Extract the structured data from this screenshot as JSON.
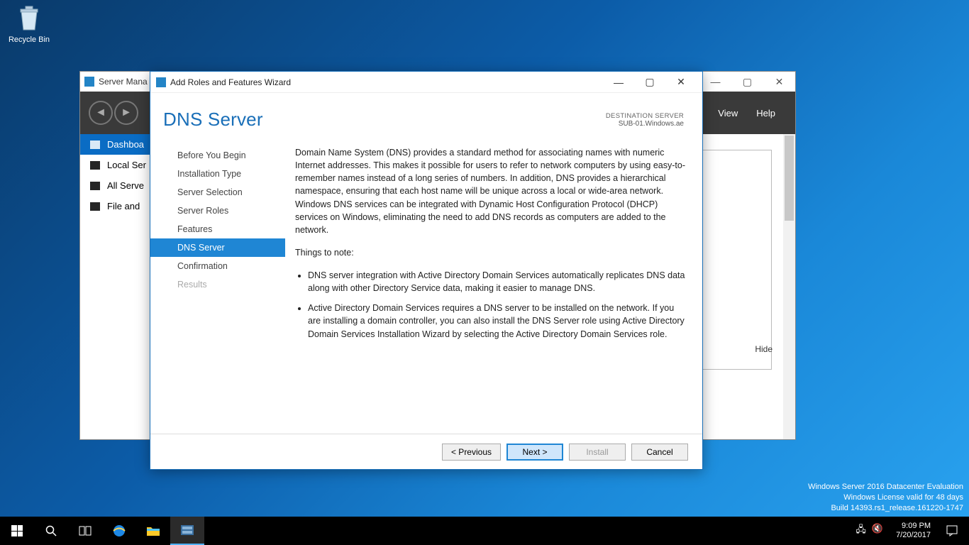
{
  "desktop": {
    "recycle_label": "Recycle Bin"
  },
  "watermark": {
    "line1": "Windows Server 2016 Datacenter Evaluation",
    "line2": "Windows License valid for 48 days",
    "line3": "Build 14393.rs1_release.161220-1747"
  },
  "servermgr": {
    "title": "Server Mana",
    "menu": {
      "view": "View",
      "help": "Help"
    },
    "sidebar": {
      "items": [
        {
          "label": "Dashboa",
          "selected": true
        },
        {
          "label": "Local Ser",
          "selected": false
        },
        {
          "label": "All Serve",
          "selected": false
        },
        {
          "label": "File and",
          "selected": false
        }
      ]
    },
    "hide": "Hide"
  },
  "wizard": {
    "title_bar": "Add Roles and Features Wizard",
    "page_title": "DNS Server",
    "dest_label": "DESTINATION SERVER",
    "dest_value": "SUB-01.Windows.ae",
    "steps": [
      {
        "label": "Before You Begin",
        "state": ""
      },
      {
        "label": "Installation Type",
        "state": ""
      },
      {
        "label": "Server Selection",
        "state": ""
      },
      {
        "label": "Server Roles",
        "state": ""
      },
      {
        "label": "Features",
        "state": ""
      },
      {
        "label": "DNS Server",
        "state": "selected"
      },
      {
        "label": "Confirmation",
        "state": ""
      },
      {
        "label": "Results",
        "state": "disabled"
      }
    ],
    "content": {
      "intro": "Domain Name System (DNS) provides a standard method for associating names with numeric Internet addresses. This makes it possible for users to refer to network computers by using easy-to-remember names instead of a long series of numbers. In addition, DNS provides a hierarchical namespace, ensuring that each host name will be unique across a local or wide-area network. Windows DNS services can be integrated with Dynamic Host Configuration Protocol (DHCP) services on Windows, eliminating the need to add DNS records as computers are added to the network.",
      "note_heading": "Things to note:",
      "bullets": [
        "DNS server integration with Active Directory Domain Services automatically replicates DNS data along with other Directory Service data, making it easier to manage DNS.",
        "Active Directory Domain Services requires a DNS server to be installed on the network. If you are installing a domain controller, you can also install the DNS Server role using Active Directory Domain Services Installation Wizard by selecting the Active Directory Domain Services role."
      ]
    },
    "buttons": {
      "prev": "< Previous",
      "next": "Next >",
      "install": "Install",
      "cancel": "Cancel"
    }
  },
  "taskbar": {
    "time": "9:09 PM",
    "date": "7/20/2017"
  }
}
